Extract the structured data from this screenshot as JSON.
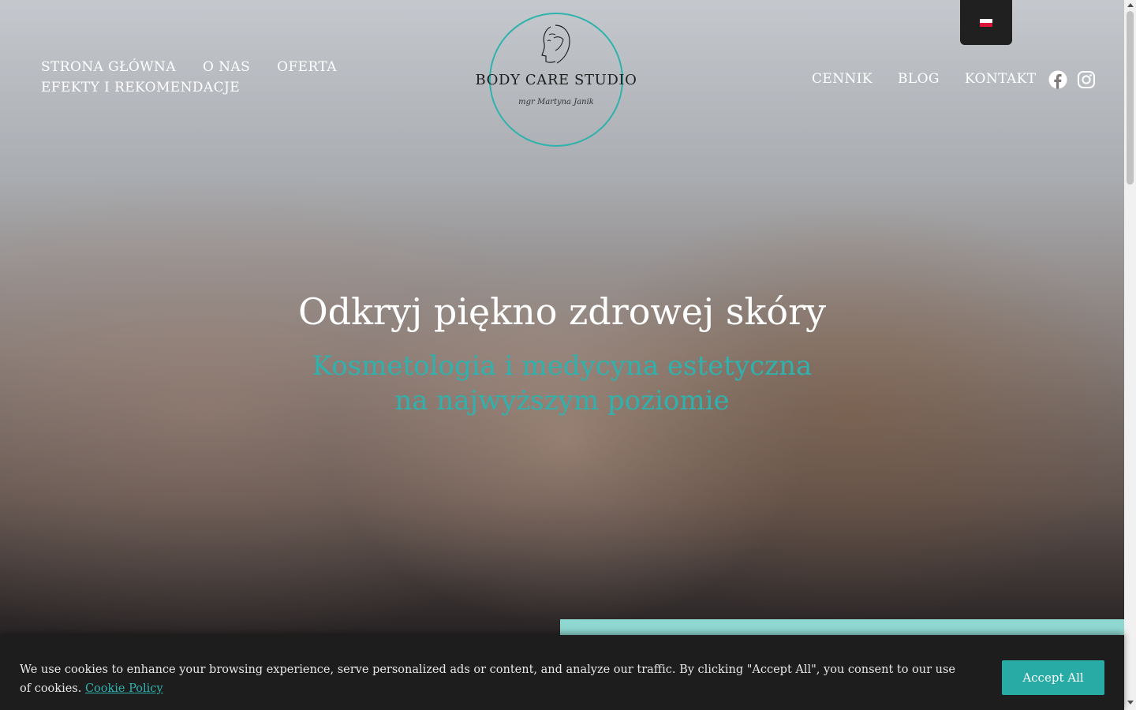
{
  "nav": {
    "left": [
      "STRONA GŁÓWNA",
      "O NAS",
      "OFERTA",
      "EFEKTY I REKOMENDACJE"
    ],
    "right": [
      "CENNIK",
      "BLOG",
      "KONTAKT"
    ]
  },
  "logo": {
    "name": "BODY CARE STUDIO",
    "signature": "mgr Martyna Janik"
  },
  "social": [
    "facebook-icon",
    "instagram-icon"
  ],
  "language": {
    "flag": "pl-flag"
  },
  "hero": {
    "headline": "Odkryj piękno zdrowej skóry",
    "subheadline": "Kosmetologia i medycyna estetyczna na najwyższym poziomie"
  },
  "cookie": {
    "text": "We use cookies to enhance your browsing experience, serve personalized ads or content, and analyze our traffic. By clicking \"Accept All\", you consent to our use of cookies.",
    "link": "Cookie Policy",
    "accept": "Accept All"
  },
  "colors": {
    "accent": "#2fb2ad",
    "cookie_bg": "#1d1d1d",
    "lang_bg": "#202020"
  }
}
